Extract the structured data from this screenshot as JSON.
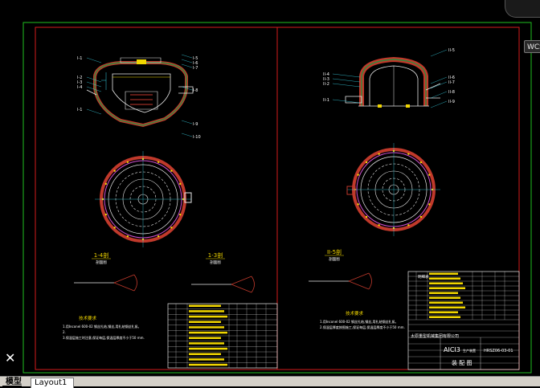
{
  "viewcube": {
    "label": "WCS"
  },
  "tabs": [
    {
      "label": "模型",
      "active": false
    },
    {
      "label": "Layout1",
      "active": true
    }
  ],
  "drawing": {
    "colors": {
      "background": "#000000",
      "frame": "#1fbf1f",
      "border": "#d41c1c",
      "vessel": "#e8e8e8",
      "refractory": "#c0392b",
      "insulation": "#2e8b3e",
      "annotation": "#39d4e6",
      "text": "#ffffff",
      "mark": "#f1d600"
    },
    "section_labels": [
      "1-4剖",
      "1-3剖",
      "II-5剖"
    ],
    "section_sublabels": [
      "剖面图",
      "剖面图",
      "剖面图"
    ],
    "left_callouts_left": [
      "I-1",
      "I-2",
      "I-3",
      "I-4",
      "I-1"
    ],
    "left_callouts_right": [
      "I-5",
      "I-6",
      "I-7",
      "I-8",
      "I-9",
      "I-10"
    ],
    "right_callouts_left": [
      "II-4",
      "II-3",
      "II-2",
      "II-1"
    ],
    "right_callouts_right": [
      "II-5",
      "II-6",
      "II-7",
      "II-8",
      "II-9"
    ],
    "notes_title_left": "技术要求",
    "notes_title_right": "技术要求",
    "notes_left": [
      "1.用Inconel 600-02 钢丝扎结,钢丝,用扎结钢丝扎紧。",
      "2.",
      "3.保温层施工时注意,保证每层,保温层厚度不小于50 mm."
    ],
    "notes_right": [
      "1.用Inconel 600-02 钢丝扎结,钢丝,用扎结钢丝扎紧。",
      "2.保温层厚度按图施工,保证每层,保温层厚度不小于50 mm."
    ],
    "title_block_company": "太原重型机械集团有限公司",
    "title_block_logo": "AICI3",
    "title_block_logo_sub": "生产装置",
    "title_block_drawing_no": "HRSZ06-03-01",
    "title_block_drawing_name": "装 配 图",
    "table_label": "明细表"
  }
}
